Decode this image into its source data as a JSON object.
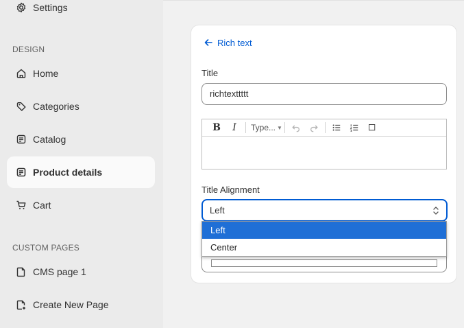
{
  "sidebar": {
    "settings_label": "Settings",
    "design_section": "DESIGN",
    "items": [
      {
        "label": "Home",
        "icon": "home-icon"
      },
      {
        "label": "Categories",
        "icon": "tag-icon"
      },
      {
        "label": "Catalog",
        "icon": "list-icon"
      },
      {
        "label": "Product details",
        "icon": "list-icon"
      },
      {
        "label": "Cart",
        "icon": "cart-icon"
      }
    ],
    "active_item": "Product details",
    "custom_pages_section": "CUSTOM PAGES",
    "custom_pages": [
      {
        "label": "CMS page 1",
        "icon": "page-icon"
      },
      {
        "label": "Create New Page",
        "icon": "page-plus-icon"
      }
    ]
  },
  "panel": {
    "back_label": "Rich text",
    "title_label": "Title",
    "title_value": "richtexttttt",
    "editor_toolbar": {
      "bold": "B",
      "italic": "I",
      "type_select": "Type..."
    },
    "alignment_label": "Title Alignment",
    "alignment_value": "Left",
    "alignment_options": [
      "Left",
      "Center"
    ]
  },
  "colors": {
    "accent": "#005bd3",
    "dropdown_selected": "#1f6fd6",
    "sidebar_bg": "#ebebeb",
    "main_bg": "#f1f1f1"
  }
}
